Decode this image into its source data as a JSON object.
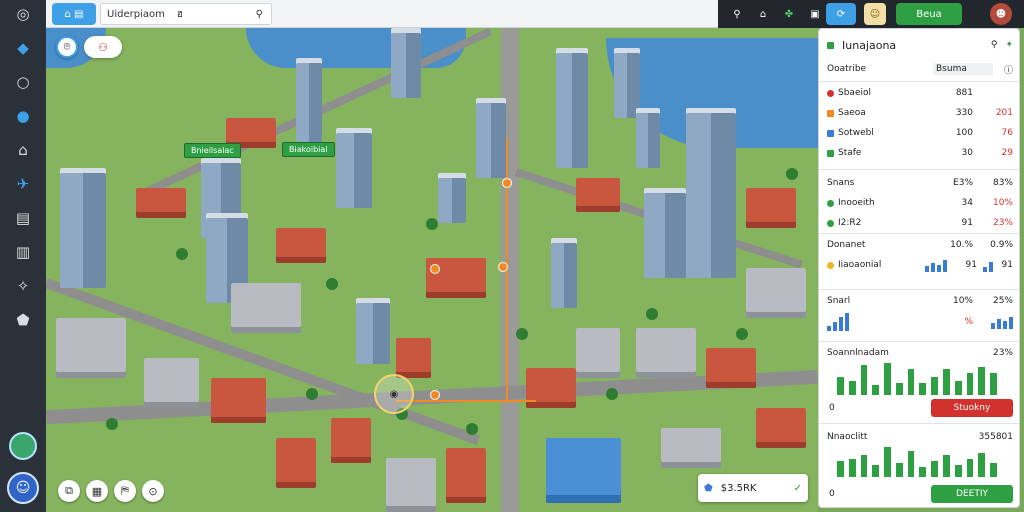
{
  "topbar": {
    "mode_button": "⌂ ▤",
    "search_text": "Uiderpiaom",
    "search_suffix": "ฮ",
    "user_button": "Beua",
    "colors": {
      "accent": "#3ea0e6",
      "green": "#2ea043",
      "dark": "#22272d"
    }
  },
  "rail": {
    "icons": [
      "github-icon",
      "map-shield-icon",
      "search-icon",
      "sync-icon",
      "home-icon",
      "twitter-icon",
      "document-icon",
      "book-icon",
      "settings-icon",
      "shield-icon"
    ],
    "avatar_glyph": "☺"
  },
  "map": {
    "labels": [
      "Bnieilsalac",
      "Biakoibial"
    ],
    "target_glyph": "◉"
  },
  "price_chip": {
    "value": "$3.5RK",
    "check": "✓"
  },
  "panel": {
    "title": "Iunajaona",
    "header": {
      "col1": "Ooatribe",
      "col2": "Bsuma"
    },
    "top_rows": [
      {
        "label": "Sbaeiol",
        "v1": "881",
        "v2": "",
        "color": "#d2322d"
      },
      {
        "label": "Saeoa",
        "v1": "330",
        "v2": "201",
        "color": "#f08a24"
      },
      {
        "label": "Sotwebl",
        "v1": "100",
        "v2": "76",
        "color": "#3a7bd5"
      },
      {
        "label": "Stafe",
        "v1": "30",
        "v2": "29",
        "color": "#2ea043"
      }
    ],
    "mid_header": {
      "label": "Snans",
      "v1": "E3%",
      "v2": "83%"
    },
    "mid_rows": [
      {
        "label": "Inooeith",
        "v1": "34",
        "v2": "10%",
        "color": "#2ea043"
      },
      {
        "label": "I2:R2",
        "v1": "91",
        "v2": "23%",
        "color": "#2ea043"
      }
    ],
    "income": {
      "label": "Donanet",
      "v1": "10.%",
      "v2": "0.9%"
    },
    "income_rows": [
      {
        "label": "Iiaoaonial",
        "v1": "91",
        "v2": "91",
        "color": "#f0b324"
      }
    ],
    "snarl": {
      "label": "Snarl",
      "v1": "10%",
      "v2": "25%",
      "pct": "%"
    },
    "activity": {
      "title": "Soannlnadam",
      "pct": "23%",
      "zero": "0",
      "button": "Stuokny"
    },
    "cashflow": {
      "title": "Nnaoclitt",
      "value": "355801",
      "zero": "0",
      "button": "DEETIY"
    },
    "chart_a": [
      18,
      14,
      30,
      10,
      32,
      12,
      26,
      12,
      18,
      26,
      14,
      22,
      28,
      22
    ],
    "chart_b": [
      16,
      18,
      22,
      12,
      30,
      14,
      26,
      10,
      16,
      22,
      12,
      18,
      24,
      14
    ]
  }
}
